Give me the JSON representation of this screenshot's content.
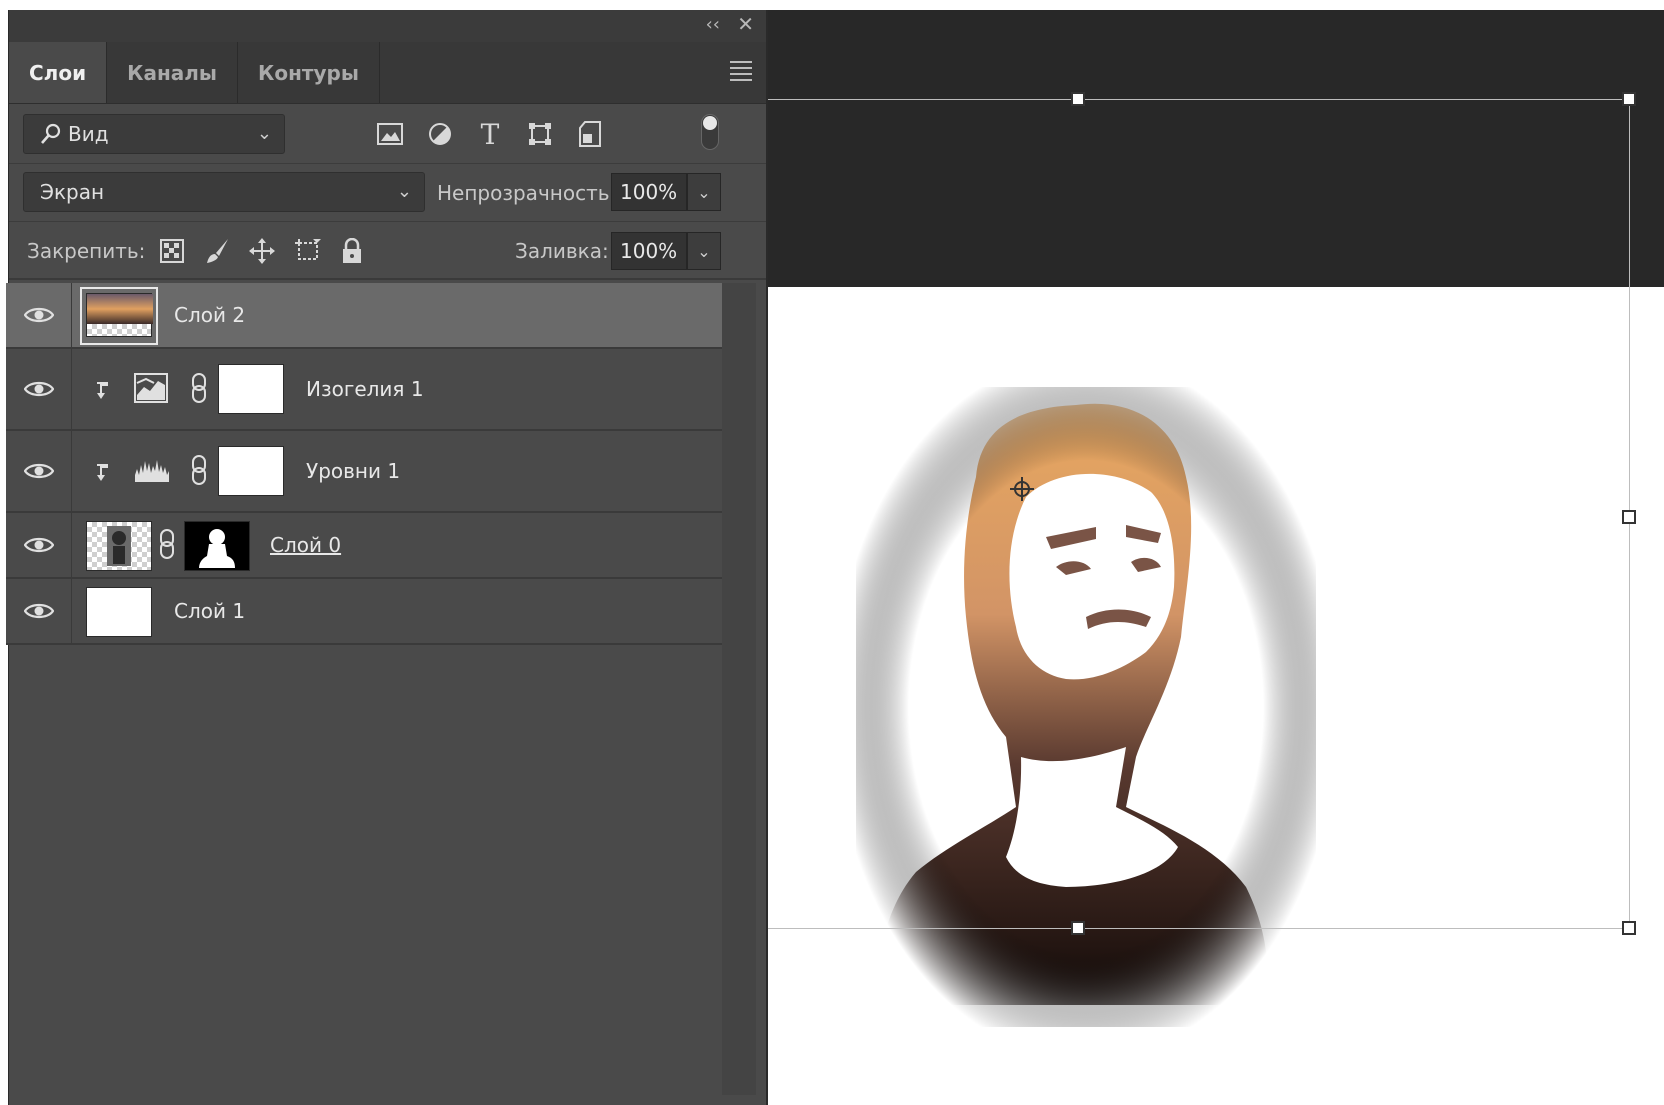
{
  "panel": {
    "tabs": [
      {
        "label": "Слои",
        "active": true
      },
      {
        "label": "Каналы",
        "active": false
      },
      {
        "label": "Контуры",
        "active": false
      }
    ],
    "collapse_glyph": "‹‹",
    "close_glyph": "✕"
  },
  "filter": {
    "kind_label": "Вид",
    "icons": [
      "image-filter-icon",
      "adjustment-filter-icon",
      "type-filter-icon",
      "shape-filter-icon",
      "smart-object-filter-icon"
    ]
  },
  "blend": {
    "mode": "Экран",
    "opacity_label": "Непрозрачность:",
    "opacity_value": "100%"
  },
  "lock": {
    "label": "Закрепить:",
    "icons": [
      "lock-transparent-icon",
      "lock-image-icon",
      "lock-position-icon",
      "lock-artboard-icon",
      "lock-all-icon"
    ],
    "fill_label": "Заливка:",
    "fill_value": "100%"
  },
  "layers": [
    {
      "name": "Слой 2",
      "type": "image",
      "selected": true,
      "visible": true
    },
    {
      "name": "Изогелия 1",
      "type": "threshold-adjustment",
      "clipped": true,
      "visible": true
    },
    {
      "name": "Уровни 1",
      "type": "levels-adjustment",
      "clipped": true,
      "visible": true
    },
    {
      "name": "Слой 0",
      "type": "masked-image",
      "visible": true
    },
    {
      "name": "Слой 1",
      "type": "fill",
      "visible": true
    }
  ],
  "colors": {
    "panel_bg": "#4a4a4a",
    "selected_row": "#6a6a6a",
    "canvas_bg": "#ffffff",
    "workspace_bg": "#282828"
  }
}
